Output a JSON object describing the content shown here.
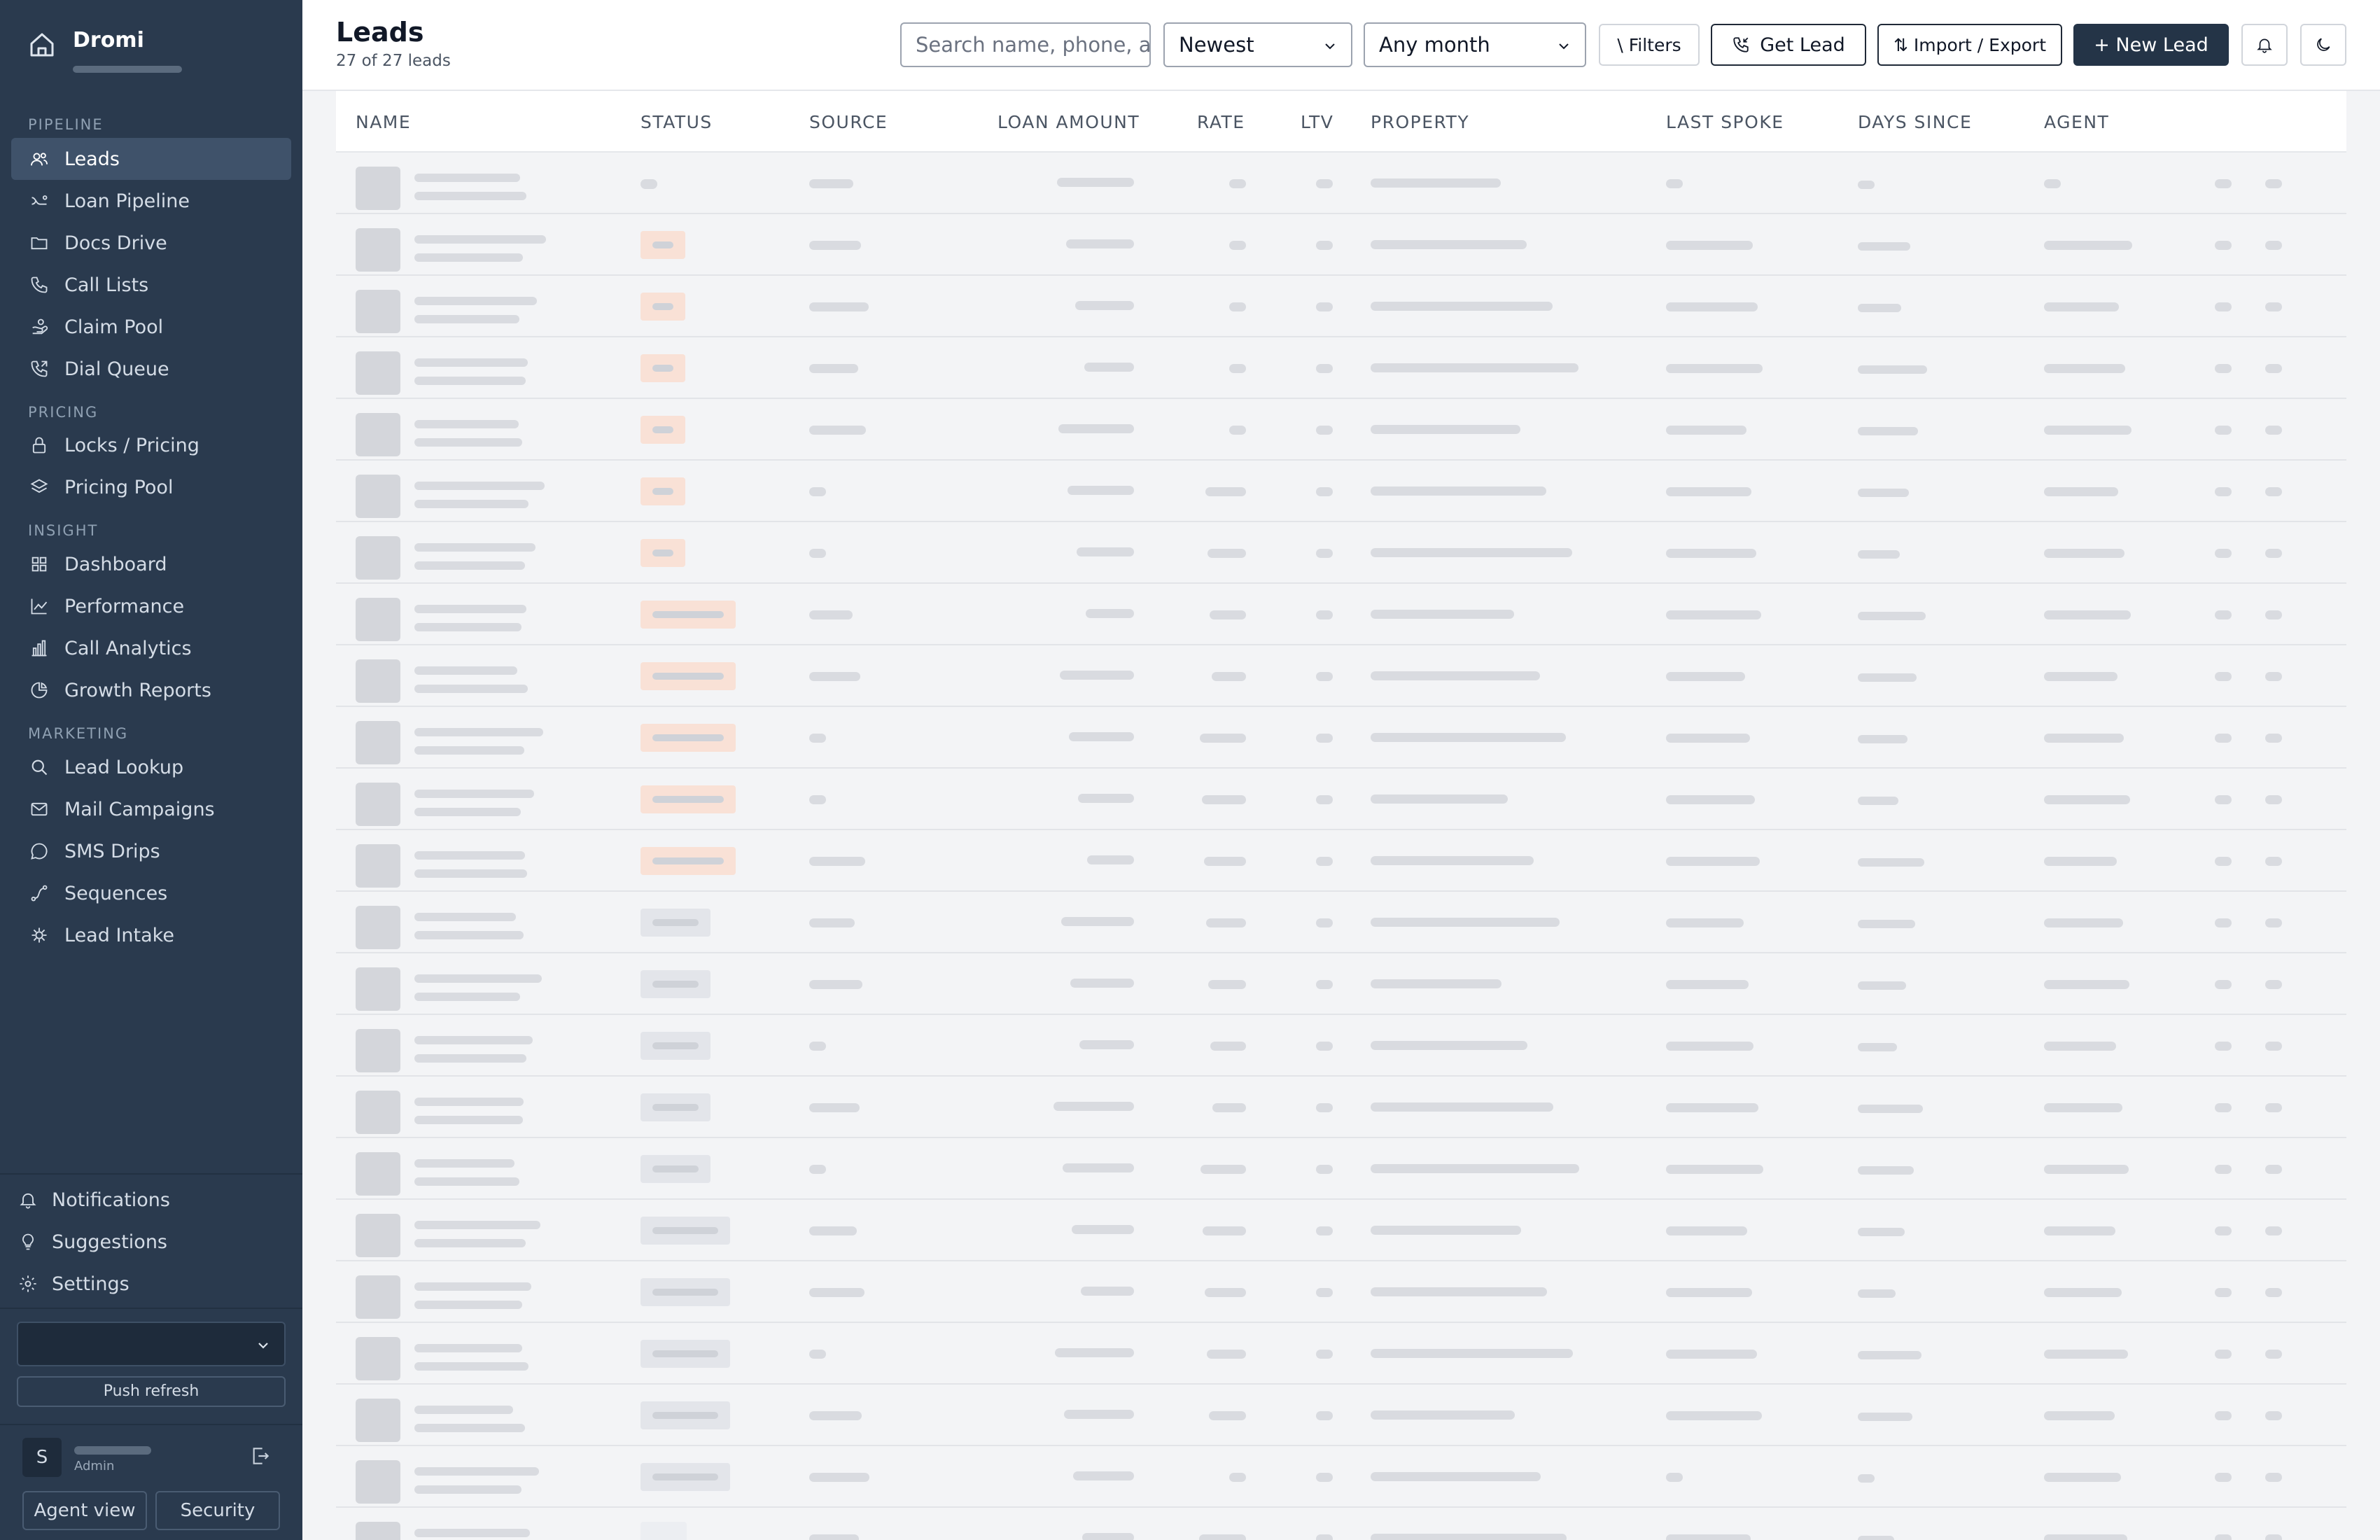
{
  "app": {
    "name": "Dromi"
  },
  "sidebar": {
    "sections": [
      {
        "label": "PIPELINE",
        "items": [
          {
            "label": "Leads",
            "icon": "users-icon",
            "active": true
          },
          {
            "label": "Loan Pipeline",
            "icon": "pipeline-icon"
          },
          {
            "label": "Docs Drive",
            "icon": "folder-icon"
          },
          {
            "label": "Call Lists",
            "icon": "phone-icon"
          },
          {
            "label": "Claim Pool",
            "icon": "hand-icon"
          },
          {
            "label": "Dial Queue",
            "icon": "phone-forward-icon"
          }
        ]
      },
      {
        "label": "PRICING",
        "items": [
          {
            "label": "Locks / Pricing",
            "icon": "lock-icon"
          },
          {
            "label": "Pricing Pool",
            "icon": "layers-icon"
          }
        ]
      },
      {
        "label": "INSIGHT",
        "items": [
          {
            "label": "Dashboard",
            "icon": "grid-icon"
          },
          {
            "label": "Performance",
            "icon": "trend-icon"
          },
          {
            "label": "Call Analytics",
            "icon": "bar-chart-icon"
          },
          {
            "label": "Growth Reports",
            "icon": "pie-icon"
          }
        ]
      },
      {
        "label": "MARKETING",
        "items": [
          {
            "label": "Lead Lookup",
            "icon": "search-icon"
          },
          {
            "label": "Mail Campaigns",
            "icon": "mail-icon"
          },
          {
            "label": "SMS Drips",
            "icon": "chat-icon"
          },
          {
            "label": "Sequences",
            "icon": "route-icon"
          },
          {
            "label": "Lead Intake",
            "icon": "plug-icon"
          }
        ]
      }
    ],
    "footer": {
      "notifications": "Notifications",
      "suggestions": "Suggestions",
      "settings": "Settings",
      "push_refresh": "Push refresh",
      "user_initial": "S",
      "user_role": "Admin",
      "agent_view": "Agent view",
      "security": "Security"
    }
  },
  "header": {
    "title": "Leads",
    "count": "27 of 27 leads",
    "search_placeholder": "Search name, phone, address…",
    "sort": "Newest",
    "month": "Any month",
    "filters": "\\ Filters",
    "get_lead": "Get Lead",
    "import_export": "⇅ Import / Export",
    "new_lead": "+ New Lead"
  },
  "table": {
    "columns": [
      "NAME",
      "STATUS",
      "SOURCE",
      "LOAN AMOUNT",
      "RATE",
      "LTV",
      "PROPERTY",
      "LAST SPOKE",
      "DAYS SINCE",
      "AGENT"
    ],
    "loading_rows": 23,
    "status_colors": [
      "#f9e1d6",
      "#e3e5ea"
    ]
  }
}
